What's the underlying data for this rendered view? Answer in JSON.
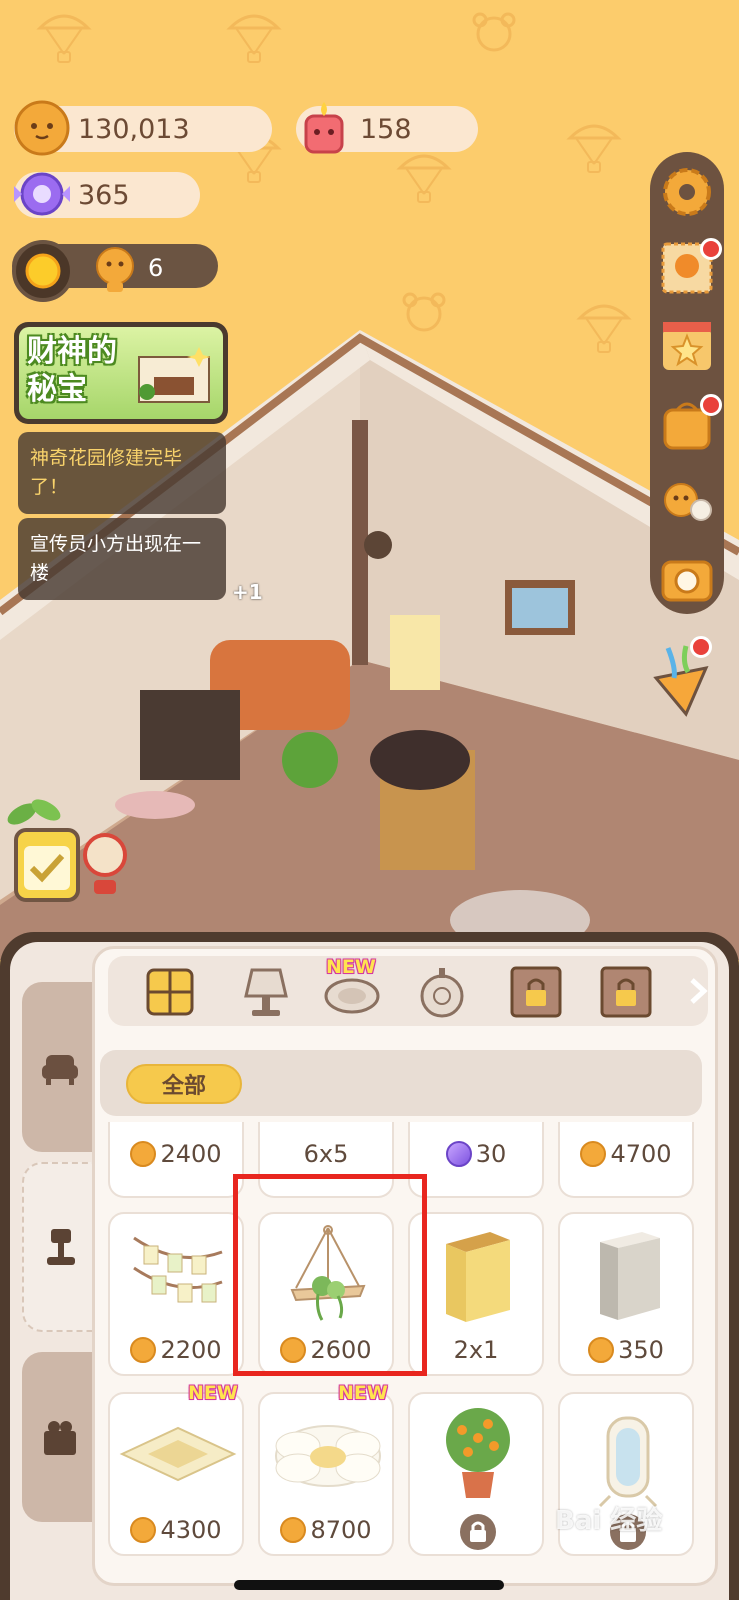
{
  "resources": {
    "cookies": "130,013",
    "candle": "158",
    "candy": "365",
    "visitors": "6"
  },
  "event_banner": {
    "title": "财神的秘宝"
  },
  "notifications": [
    "神奇花园修建完毕了！",
    "宣传员小方出现在一楼"
  ],
  "notifications_extra": "+1",
  "category_tabs": [
    {
      "icon": "grid-icon",
      "new": false,
      "locked": false
    },
    {
      "icon": "lamp-icon",
      "new": false,
      "locked": false
    },
    {
      "icon": "rug-icon",
      "new": true,
      "new_label": "NEW",
      "locked": false
    },
    {
      "icon": "wall-clock-icon",
      "new": false,
      "locked": false
    },
    {
      "icon": "locked-frame-icon",
      "new": false,
      "locked": true
    },
    {
      "icon": "locked-frame-icon",
      "new": false,
      "locked": true
    }
  ],
  "filter": {
    "label": "全部"
  },
  "items_top_row": [
    {
      "price": "2400",
      "currency": "coin"
    },
    {
      "price": "6x5",
      "currency": "none"
    },
    {
      "price": "30",
      "currency": "gem"
    },
    {
      "price": "4700",
      "currency": "coin"
    }
  ],
  "items_mid_row": [
    {
      "name": "photo-garland",
      "price": "2200",
      "currency": "coin"
    },
    {
      "name": "hanging-plant",
      "price": "2600",
      "currency": "coin"
    },
    {
      "name": "yellow-cabinet",
      "price": "2x1",
      "currency": "none"
    },
    {
      "name": "grey-cabinet",
      "price": "350",
      "currency": "coin"
    }
  ],
  "items_bottom_row": [
    {
      "name": "yellow-rug",
      "price": "4300",
      "currency": "coin",
      "new": true,
      "new_label": "NEW"
    },
    {
      "name": "flower-rug",
      "price": "8700",
      "currency": "coin",
      "new": true,
      "new_label": "NEW"
    },
    {
      "name": "orange-tree",
      "price": "",
      "currency": "locked"
    },
    {
      "name": "mirror",
      "price": "",
      "currency": "locked"
    }
  ],
  "watermark": "Bai 经验",
  "colors": {
    "background": "#fccc6c",
    "panel": "#4f3b2e",
    "highlight": "#e8261f",
    "coin": "#f3a93a"
  }
}
